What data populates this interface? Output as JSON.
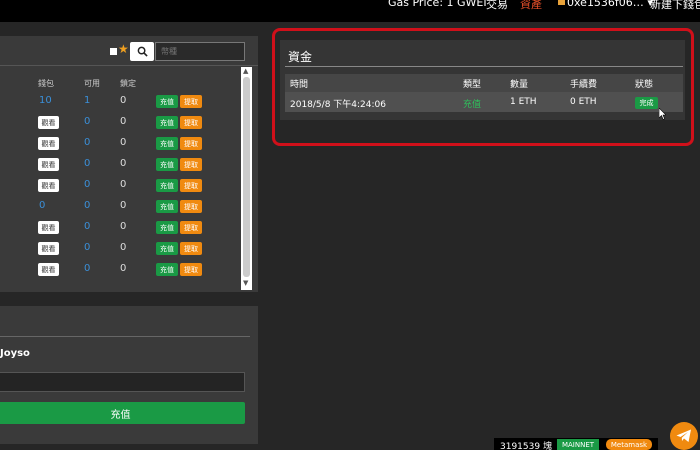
{
  "topbar": {
    "gas_price": "Gas Price: 1 GWEI",
    "nav_trade": "交易",
    "nav_assets": "資產",
    "account": "0xe1536f06…",
    "new_wallet": "新建下錢包"
  },
  "wallet": {
    "search_placeholder": "幣種",
    "columns": [
      "錢包",
      "可用",
      "鎖定"
    ],
    "rows": [
      {
        "wallet": "10",
        "available": "1",
        "locked": "0",
        "deposit": "充值",
        "withdraw": "提取"
      },
      {
        "view": "觀看",
        "available": "0",
        "locked": "0",
        "deposit": "充值",
        "withdraw": "提取"
      },
      {
        "view": "觀看",
        "available": "0",
        "locked": "0",
        "deposit": "充值",
        "withdraw": "提取"
      },
      {
        "view": "觀看",
        "available": "0",
        "locked": "0",
        "deposit": "充值",
        "withdraw": "提取"
      },
      {
        "view": "觀看",
        "available": "0",
        "locked": "0",
        "deposit": "充值",
        "withdraw": "提取"
      },
      {
        "wallet": "0",
        "available": "0",
        "locked": "0",
        "deposit": "充值",
        "withdraw": "提取"
      },
      {
        "view": "觀看",
        "available": "0",
        "locked": "0",
        "deposit": "充值",
        "withdraw": "提取"
      },
      {
        "view": "觀看",
        "available": "0",
        "locked": "0",
        "deposit": "充值",
        "withdraw": "提取"
      },
      {
        "view": "觀看",
        "available": "0",
        "locked": "0",
        "deposit": "充值",
        "withdraw": "提取"
      }
    ]
  },
  "deposit_panel": {
    "token_name": "Joyso",
    "submit_label": "充值"
  },
  "funds": {
    "title": "資金",
    "columns": [
      "時間",
      "類型",
      "數量",
      "手續費",
      "狀態"
    ],
    "rows": [
      {
        "time": "2018/5/8 下午4:24:06",
        "type": "充值",
        "amount": "1 ETH",
        "fee": "0 ETH",
        "status": "完成"
      }
    ]
  },
  "status_bar": {
    "block": "3191539 塊",
    "network": "MAINNET",
    "wallet_provider": "Metamask"
  },
  "colors": {
    "accent_green": "#1a9a45",
    "accent_orange": "#f08a10",
    "highlight_red": "#d0101a",
    "link_blue": "#3a8fd8"
  }
}
